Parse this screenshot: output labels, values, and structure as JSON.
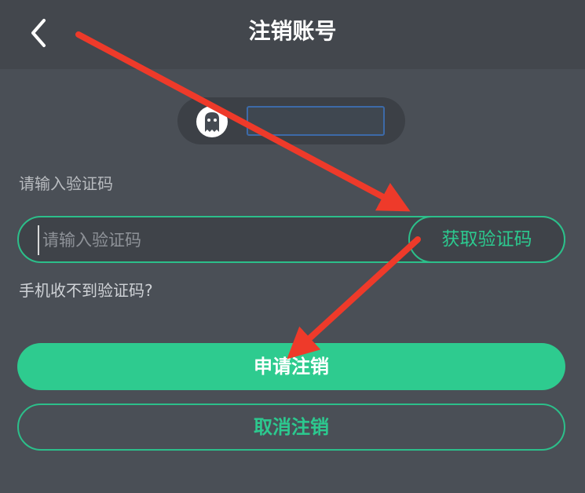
{
  "nav": {
    "title": "注销账号",
    "back_icon": "chevron-left-icon"
  },
  "account": {
    "avatar_icon": "ghost-avatar-icon"
  },
  "verification": {
    "label": "请输入验证码",
    "placeholder": "请输入验证码",
    "value": "",
    "get_code_label": "获取验证码"
  },
  "help": {
    "no_code_link": "手机收不到验证码?"
  },
  "actions": {
    "apply_label": "申请注销",
    "cancel_label": "取消注销"
  },
  "colors": {
    "background": "#4a4f56",
    "accent": "#2ecb8f",
    "annotation_arrow": "#ee3a2a"
  }
}
